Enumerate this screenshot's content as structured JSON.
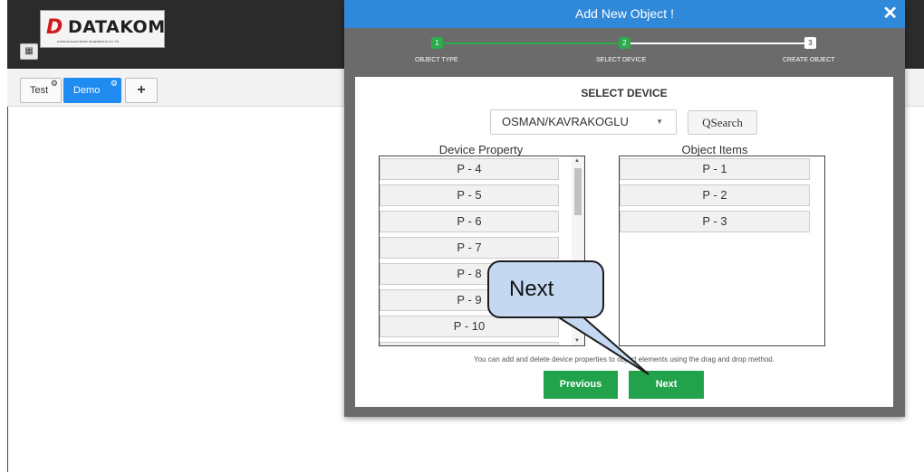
{
  "header": {
    "logo_mark": "D",
    "logo_text": "DATAKOM",
    "logo_sub": "DATAKOM ELEKTRONIK MUHENDISLIK LTD. STI."
  },
  "tabs": [
    {
      "label": "Test"
    },
    {
      "label": "Demo"
    },
    {
      "label": "+"
    }
  ],
  "modal": {
    "title": "Add New Object !",
    "close": "✕",
    "steps": [
      {
        "number": "1",
        "label": "OBJECT TYPE"
      },
      {
        "number": "2",
        "label": "SELECT DEVICE"
      },
      {
        "number": "3",
        "label": "CREATE OBJECT"
      }
    ],
    "section_title": "SELECT DEVICE",
    "device_select": "OSMAN/KAVRAKOGLU",
    "search_label": "QSearch",
    "device_property_title": "Device Property",
    "object_items_title": "Object Items",
    "device_properties": [
      "P - 4",
      "P - 5",
      "P - 6",
      "P - 7",
      "P - 8",
      "P - 9",
      "P - 10"
    ],
    "object_items": [
      "P - 1",
      "P - 2",
      "P - 3"
    ],
    "hint": "You can add and delete device properties to object elements using the drag and drop method.",
    "previous_label": "Previous",
    "next_label": "Next"
  },
  "callout": {
    "text": "Next"
  },
  "colors": {
    "header_blue": "#2f88d8",
    "success_green": "#22a24a",
    "tab_active": "#1f8bf0",
    "callout_fill": "#c5d8f2"
  }
}
